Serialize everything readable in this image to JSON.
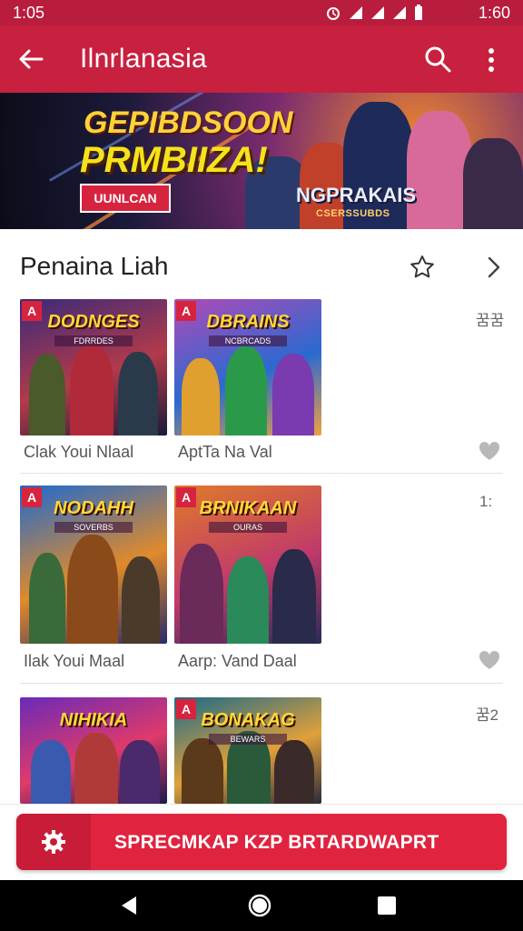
{
  "status": {
    "time_left": "1:05",
    "time_right": "1:60"
  },
  "app": {
    "title": "Ilnrlanasia"
  },
  "banner": {
    "headline1": "GEPIBDSOON",
    "headline2": "PRMBIIZA!",
    "cta": "UUNLCAN",
    "game_logo": "NGPRAKAIS",
    "game_sub": "CSERSSUBDS"
  },
  "section": {
    "title": "Penaina Liah"
  },
  "rows": [
    {
      "meta": "꿈꿈",
      "items": [
        {
          "badge": "A",
          "title": "DODNGES",
          "sub": "FDRRDES",
          "caption": "Clak Youi Nlaal",
          "colors": [
            "#3a2a7a",
            "#b23a4a",
            "#1a1a3a"
          ]
        },
        {
          "badge": "A",
          "title": "DBRAINS",
          "sub": "NCBRCADS",
          "caption": "AptTa Na Val",
          "colors": [
            "#b04ab8",
            "#2a6ad0",
            "#f0a040"
          ]
        }
      ]
    },
    {
      "meta": "1:",
      "items": [
        {
          "badge": "A",
          "title": "NODAHH",
          "sub": "SOVERBS",
          "caption": "Ilak Youi Maal",
          "colors": [
            "#1e6ad0",
            "#e08a2a",
            "#2a2a6a"
          ]
        },
        {
          "badge": "A",
          "title": "BRNIKAAN",
          "sub": "OURAS",
          "caption": "Aarp: Vand Daal",
          "colors": [
            "#e07a2a",
            "#c03a6a",
            "#2a2a5a"
          ]
        }
      ]
    },
    {
      "meta": "꿈2",
      "items": [
        {
          "badge": "",
          "title": "NIHIKIA",
          "sub": "",
          "caption": "",
          "colors": [
            "#6a2ab8",
            "#e03a6a",
            "#1a1a4a"
          ]
        },
        {
          "badge": "A",
          "title": "BONAKAG",
          "sub": "BEWARS",
          "caption": "",
          "colors": [
            "#1a6a8a",
            "#e0a03a",
            "#2a2a3a"
          ]
        }
      ]
    }
  ],
  "action": {
    "label": "SPRECMKAP KZP BRTARDWAPRT"
  },
  "icons": {
    "back": "arrow-back-icon",
    "search": "search-icon",
    "more": "more-vert-icon",
    "star": "star-outline-icon",
    "chevron": "chevron-right-icon",
    "heart": "heart-icon",
    "gear": "gear-icon",
    "nav_back": "nav-back-icon",
    "nav_home": "nav-home-icon",
    "nav_recents": "nav-recents-icon"
  },
  "colors": {
    "primary": "#c8203f",
    "status": "#b81d3d",
    "accent": "#e0243f"
  }
}
